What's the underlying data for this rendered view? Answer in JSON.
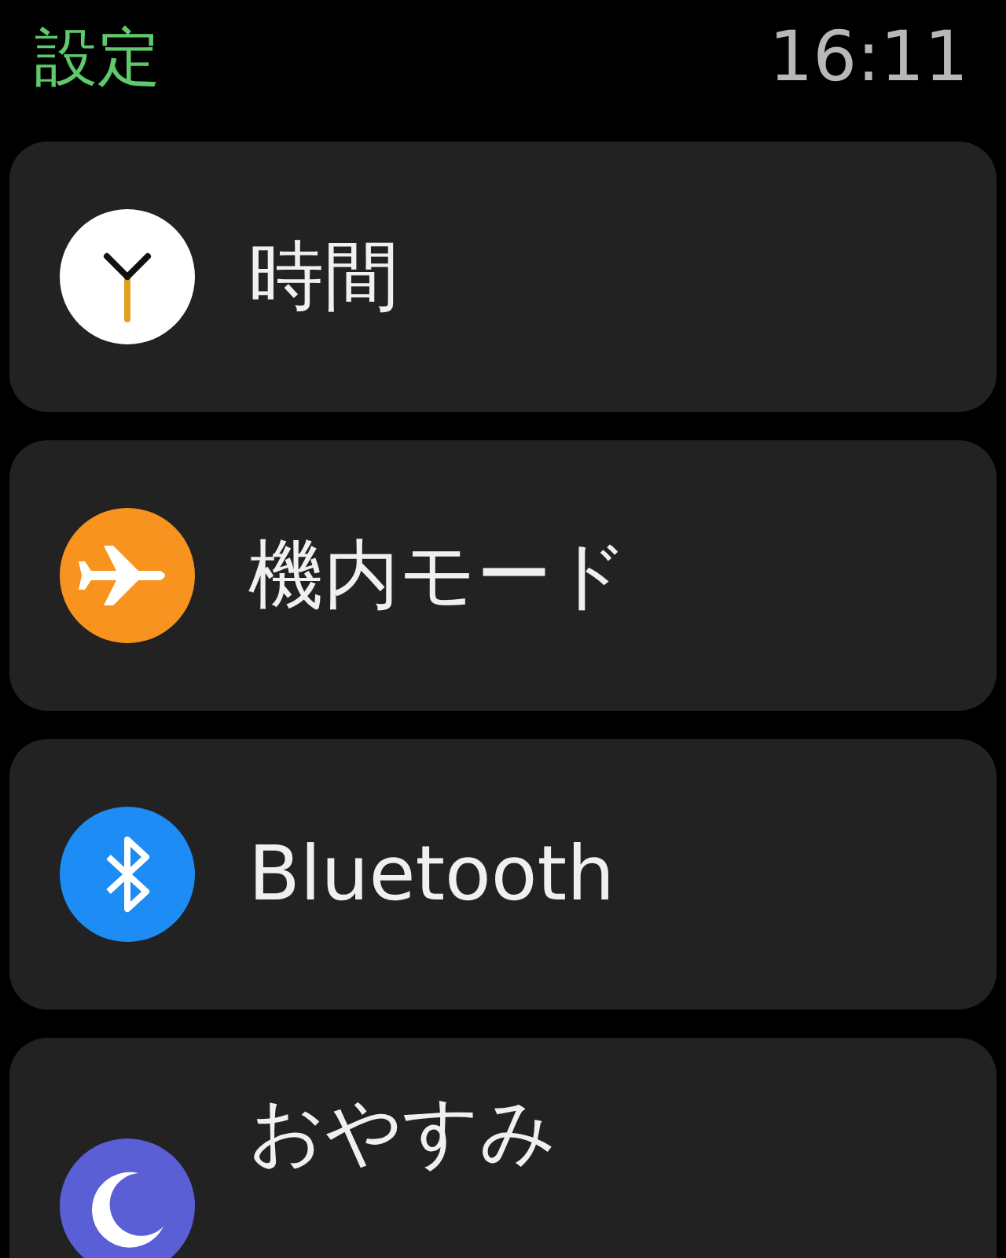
{
  "header": {
    "title": "設定",
    "time": "16:11"
  },
  "items": [
    {
      "label": "時間",
      "kind": "clock"
    },
    {
      "label": "機内モード",
      "kind": "airplane"
    },
    {
      "label": "Bluetooth",
      "kind": "bluetooth"
    },
    {
      "label": "おやすみ",
      "kind": "moon"
    }
  ]
}
